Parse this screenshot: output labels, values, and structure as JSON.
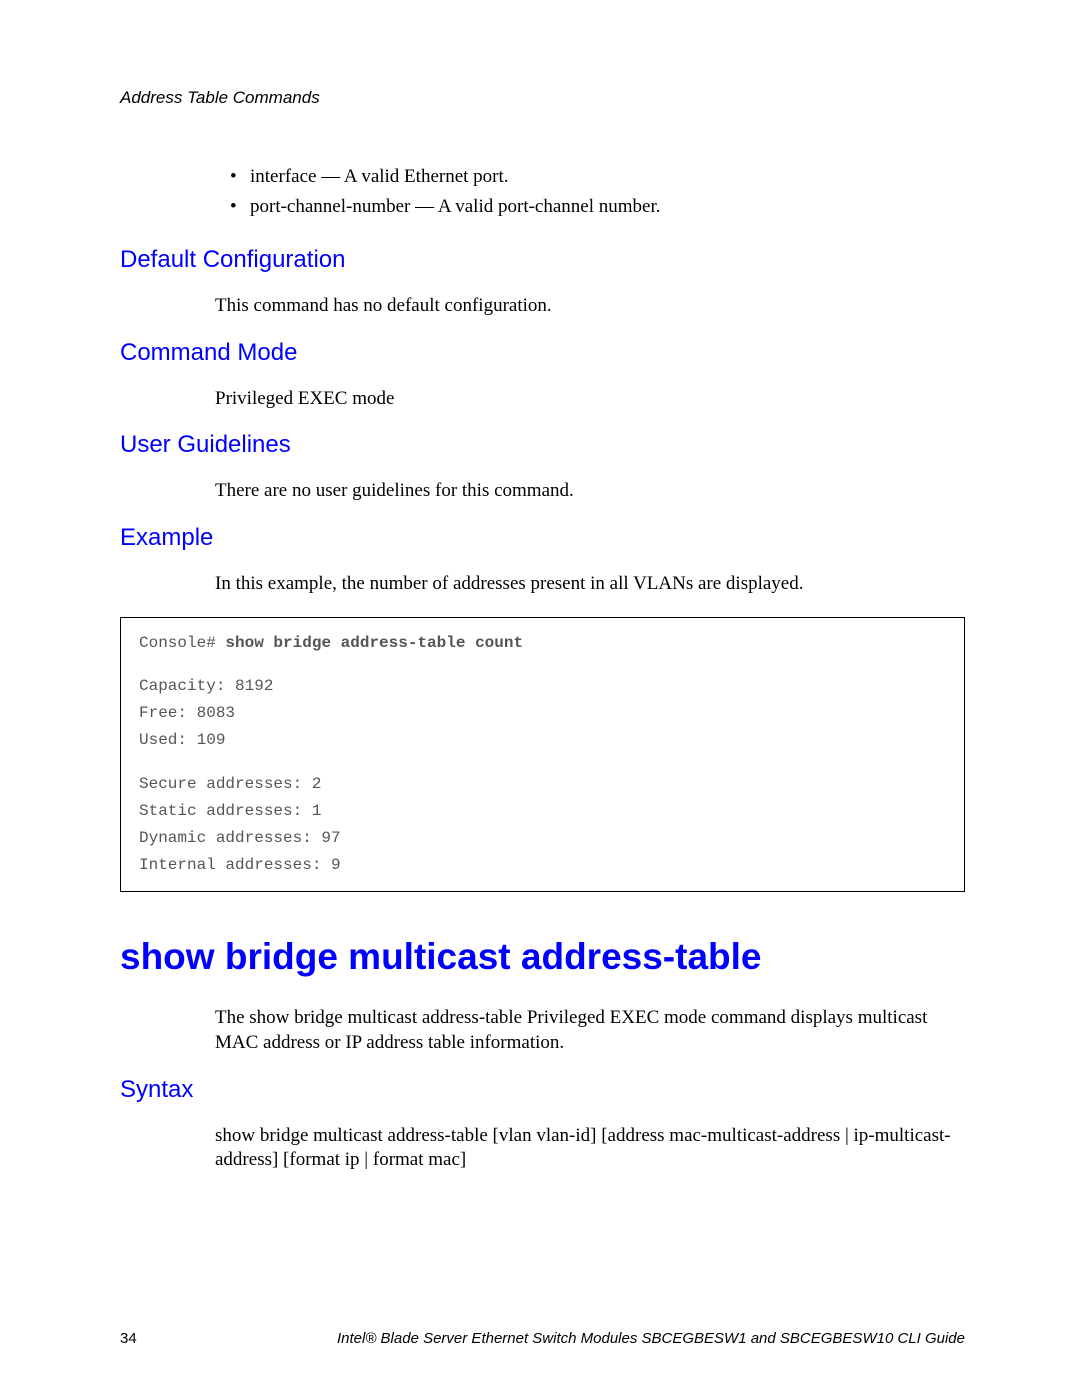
{
  "header": {
    "chapter": "Address Table Commands"
  },
  "bullets": [
    "interface — A valid Ethernet port.",
    "port-channel-number — A valid port-channel number."
  ],
  "sections": {
    "default_config": {
      "heading": "Default Configuration",
      "body": "This command has no default configuration."
    },
    "command_mode": {
      "heading": "Command Mode",
      "body": "Privileged EXEC mode"
    },
    "user_guidelines": {
      "heading": "User Guidelines",
      "body": "There are no user guidelines for this command."
    },
    "example": {
      "heading": "Example",
      "body": "In this example, the number of addresses present in all VLANs are displayed."
    },
    "syntax": {
      "heading": "Syntax",
      "body": "show bridge multicast address-table [vlan vlan-id] [address mac-multicast-address | ip-multicast-address] [format ip | format mac]"
    }
  },
  "code_example": {
    "prompt": "Console# ",
    "command": "show bridge address-table count",
    "lines": [
      "Capacity: 8192",
      "Free: 8083",
      "Used: 109"
    ],
    "lines2": [
      "Secure addresses: 2",
      "Static addresses: 1",
      "Dynamic addresses: 97",
      "Internal addresses: 9"
    ]
  },
  "main_command": {
    "title": "show bridge multicast address-table",
    "description": "The show bridge multicast address-table Privileged EXEC mode command displays multicast MAC address or IP address table information."
  },
  "footer": {
    "page_number": "34",
    "guide_title": "Intel® Blade Server Ethernet Switch Modules SBCEGBESW1 and SBCEGBESW10 CLI Guide"
  }
}
